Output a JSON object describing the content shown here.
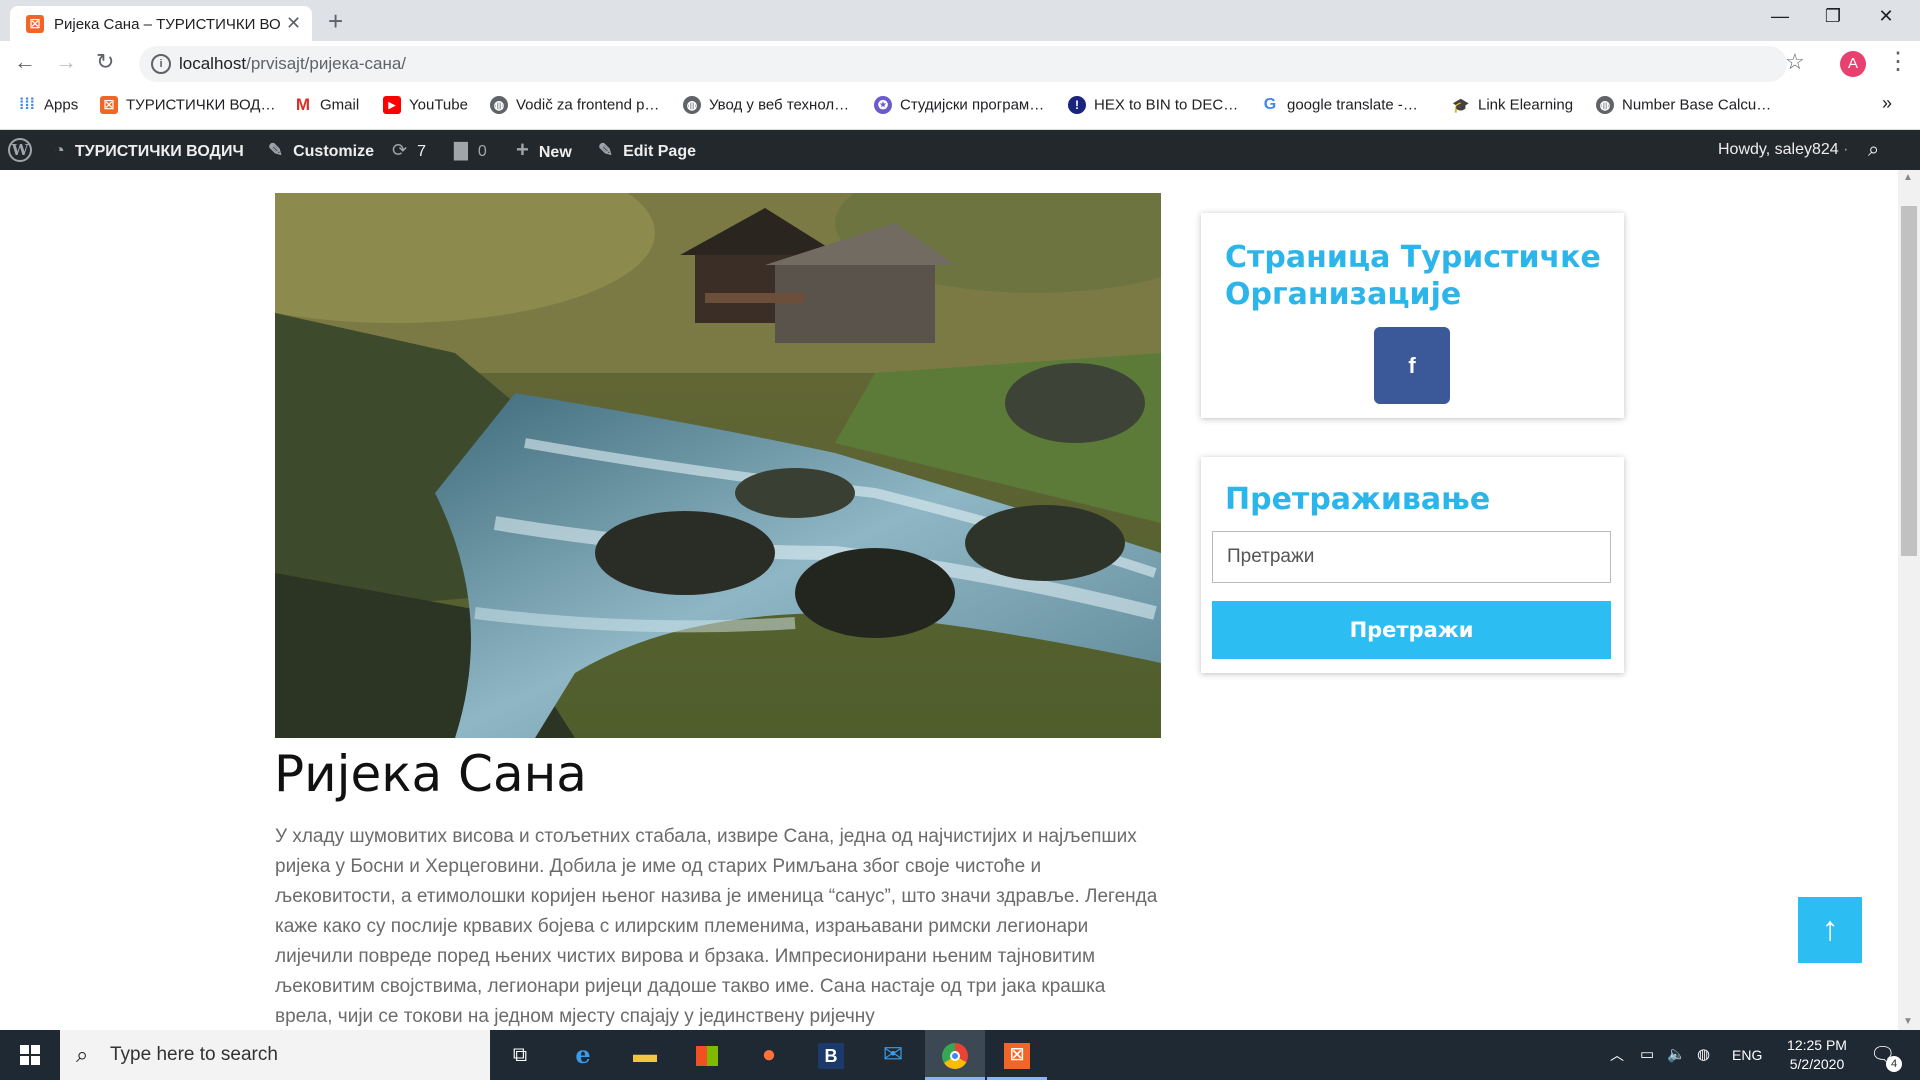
{
  "browser": {
    "tab_title": "Ријека Сана – ТУРИСТИЧКИ ВО…",
    "tab_close": "✕",
    "new_tab": "+",
    "window_controls": {
      "minimize": "—",
      "maximize": "❐",
      "close": "✕"
    },
    "url_host": "localhost",
    "url_path": "/prvisajt/ријека-сана/",
    "profile_initial": "A",
    "bookmarks": [
      {
        "label": "Apps",
        "icon": "apps-grid-icon",
        "color": "#4285f4"
      },
      {
        "label": "ТУРИСТИЧКИ ВОД…",
        "icon": "xampp-icon",
        "color": "#f16529"
      },
      {
        "label": "Gmail",
        "icon": "gmail-icon",
        "color": "#d93025"
      },
      {
        "label": "YouTube",
        "icon": "youtube-icon",
        "color": "#ff0000"
      },
      {
        "label": "Vodič za frontend p…",
        "icon": "globe-icon",
        "color": "#5f6368"
      },
      {
        "label": "Увод у веб технол…",
        "icon": "globe-icon",
        "color": "#5f6368"
      },
      {
        "label": "Студијски програм…",
        "icon": "university-icon",
        "color": "#6a5acd"
      },
      {
        "label": "HEX to BIN to DEC…",
        "icon": "hex-icon",
        "color": "#1a237e"
      },
      {
        "label": "google translate -…",
        "icon": "google-icon",
        "color": "#4285f4"
      },
      {
        "label": "Link Elearning",
        "icon": "elearning-icon",
        "color": "#555555"
      },
      {
        "label": "Number Base Calcu…",
        "icon": "globe-icon",
        "color": "#5f6368"
      }
    ],
    "bookmarks_more": "»"
  },
  "adminbar": {
    "site_name": "ТУРИСТИЧКИ ВОДИЧ",
    "customize": "Customize",
    "updates_count": "7",
    "comments_count": "0",
    "new_label": "New",
    "edit_page": "Edit Page",
    "howdy": "Howdy, saley824"
  },
  "post": {
    "title": "Ријека Сана",
    "body": "У хладу шумовитих висова и стољетних стабала, извире Сана, једна од најчистијих и најљепших ријека у Босни и Херцеговини. Добила је име од старих Римљана због своје чистоће и љековитости, а етимолошки коријен њеног назива је именица “санус”, што значи здравље. Легенда каже како су послије крвавих бојева с илирским племенима, израњавани римски легионари лијечили повреде поред њених чистих вирова и брзака. Импресионирани њеним тајновитим љековитим својствима, легионари ријеци дадоше такво име. Сана настаје од три јака крашка врела, чији се токови на једном мјесту спајају у јединствену ријечну"
  },
  "sidebar": {
    "widget1_title": "Страница Туристичке Организације",
    "facebook_label": "f",
    "widget2_title": "Претраживање",
    "search_placeholder": "Претражи",
    "search_button": "Претражи"
  },
  "back_to_top": "↑",
  "taskbar": {
    "search_text": "Type here to search",
    "language": "ENG",
    "time": "12:25 PM",
    "date": "5/2/2020",
    "notifications_count": "4"
  },
  "colors": {
    "accent": "#2cbef2",
    "widget_title": "#2cb5ea",
    "facebook": "#3b5998",
    "adminbar": "#23282d"
  }
}
